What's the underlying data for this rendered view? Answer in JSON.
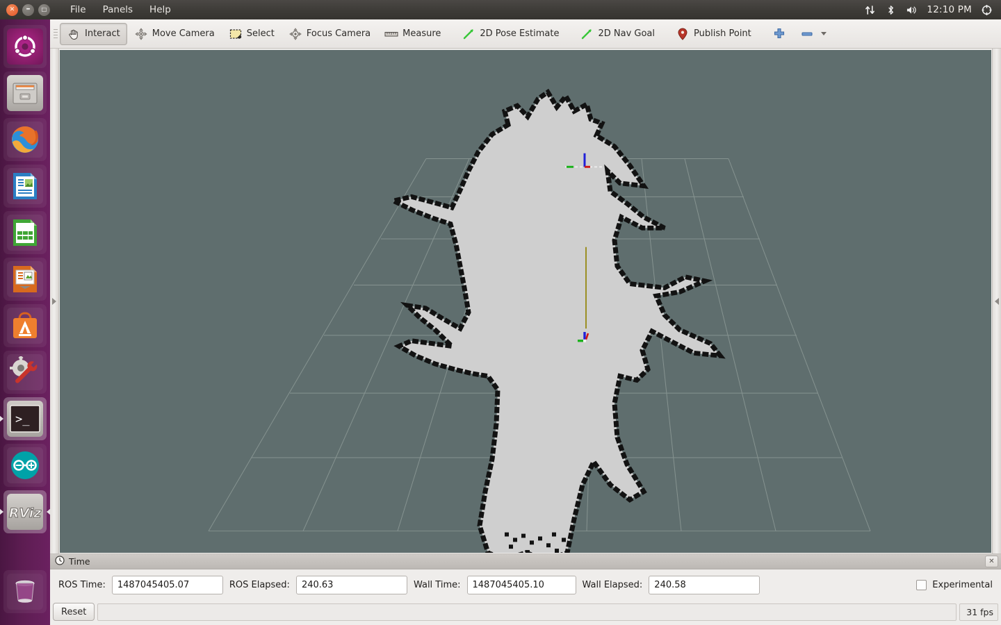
{
  "top_panel": {
    "window_controls": [
      {
        "name": "close",
        "glyph": "✕"
      },
      {
        "name": "minimize",
        "glyph": "–"
      },
      {
        "name": "maximize",
        "glyph": "□"
      }
    ],
    "menus": [
      {
        "label": "File"
      },
      {
        "label": "Panels"
      },
      {
        "label": "Help"
      }
    ],
    "tray": {
      "network_icon": "network-updown-icon",
      "bluetooth_icon": "bluetooth-icon",
      "volume_icon": "volume-icon",
      "clock": "12:10 PM",
      "system_icon": "system-gear-icon"
    }
  },
  "launcher": {
    "items": [
      {
        "name": "ubuntu-dash",
        "label": "Ubuntu Dash",
        "active": false
      },
      {
        "name": "files",
        "label": "Files",
        "active": false
      },
      {
        "name": "firefox",
        "label": "Firefox Web Browser",
        "active": false
      },
      {
        "name": "libreoffice-writer",
        "label": "LibreOffice Writer",
        "active": false
      },
      {
        "name": "libreoffice-calc",
        "label": "LibreOffice Calc",
        "active": false
      },
      {
        "name": "libreoffice-impress",
        "label": "LibreOffice Impress",
        "active": false
      },
      {
        "name": "ubuntu-software",
        "label": "Ubuntu Software",
        "active": false
      },
      {
        "name": "system-settings",
        "label": "System Settings",
        "active": false
      },
      {
        "name": "terminal",
        "label": "Terminal",
        "active": true
      },
      {
        "name": "arduino",
        "label": "Arduino IDE",
        "active": false
      },
      {
        "name": "rviz",
        "label": "RViz",
        "active": true
      }
    ],
    "trash": {
      "name": "trash",
      "label": "Trash"
    }
  },
  "toolbar": {
    "tools": [
      {
        "label": "Interact",
        "icon": "hand-cursor-icon",
        "checked": true
      },
      {
        "label": "Move Camera",
        "icon": "move-camera-icon",
        "checked": false
      },
      {
        "label": "Select",
        "icon": "select-rectangle-icon",
        "checked": false
      },
      {
        "label": "Focus Camera",
        "icon": "focus-camera-icon",
        "checked": false
      },
      {
        "label": "Measure",
        "icon": "ruler-icon",
        "checked": false
      },
      {
        "label": "2D Pose Estimate",
        "icon": "green-arrow-icon",
        "checked": false
      },
      {
        "label": "2D Nav Goal",
        "icon": "green-arrow-icon",
        "checked": false
      },
      {
        "label": "Publish Point",
        "icon": "map-pin-icon",
        "checked": false
      }
    ],
    "add_tool_icon": "plus-icon",
    "remove_tool_icon": "minus-icon",
    "remove_tool_dropdown_icon": "chevron-down-icon"
  },
  "render_view": {
    "background_color": "#5f6e6e",
    "grid_color": "#8d9a97",
    "map_free_color": "#cfcfcf",
    "map_occupied_color": "#111111",
    "pose_axis_colors": {
      "x": "#d01818",
      "y": "#19b219",
      "z": "#2020d8"
    },
    "path_line_color": "#9b8f24",
    "origin_axes_colors": {
      "x": "#d01818",
      "y": "#19b219",
      "z": "#2020d8"
    }
  },
  "panels": {
    "left_splitter_icon": "chevron-right-icon",
    "right_splitter_icon": "chevron-left-icon"
  },
  "time_panel": {
    "title": "Time",
    "clock_icon": "clock-icon",
    "close_icon": "close-icon",
    "fields": [
      {
        "label": "ROS Time:",
        "value": "1487045405.07"
      },
      {
        "label": "ROS Elapsed:",
        "value": "240.63"
      },
      {
        "label": "Wall Time:",
        "value": "1487045405.10"
      },
      {
        "label": "Wall Elapsed:",
        "value": "240.58"
      }
    ],
    "experimental": {
      "label": "Experimental",
      "checked": false
    }
  },
  "status_bar": {
    "reset_label": "Reset",
    "message": "",
    "fps": "31 fps"
  }
}
